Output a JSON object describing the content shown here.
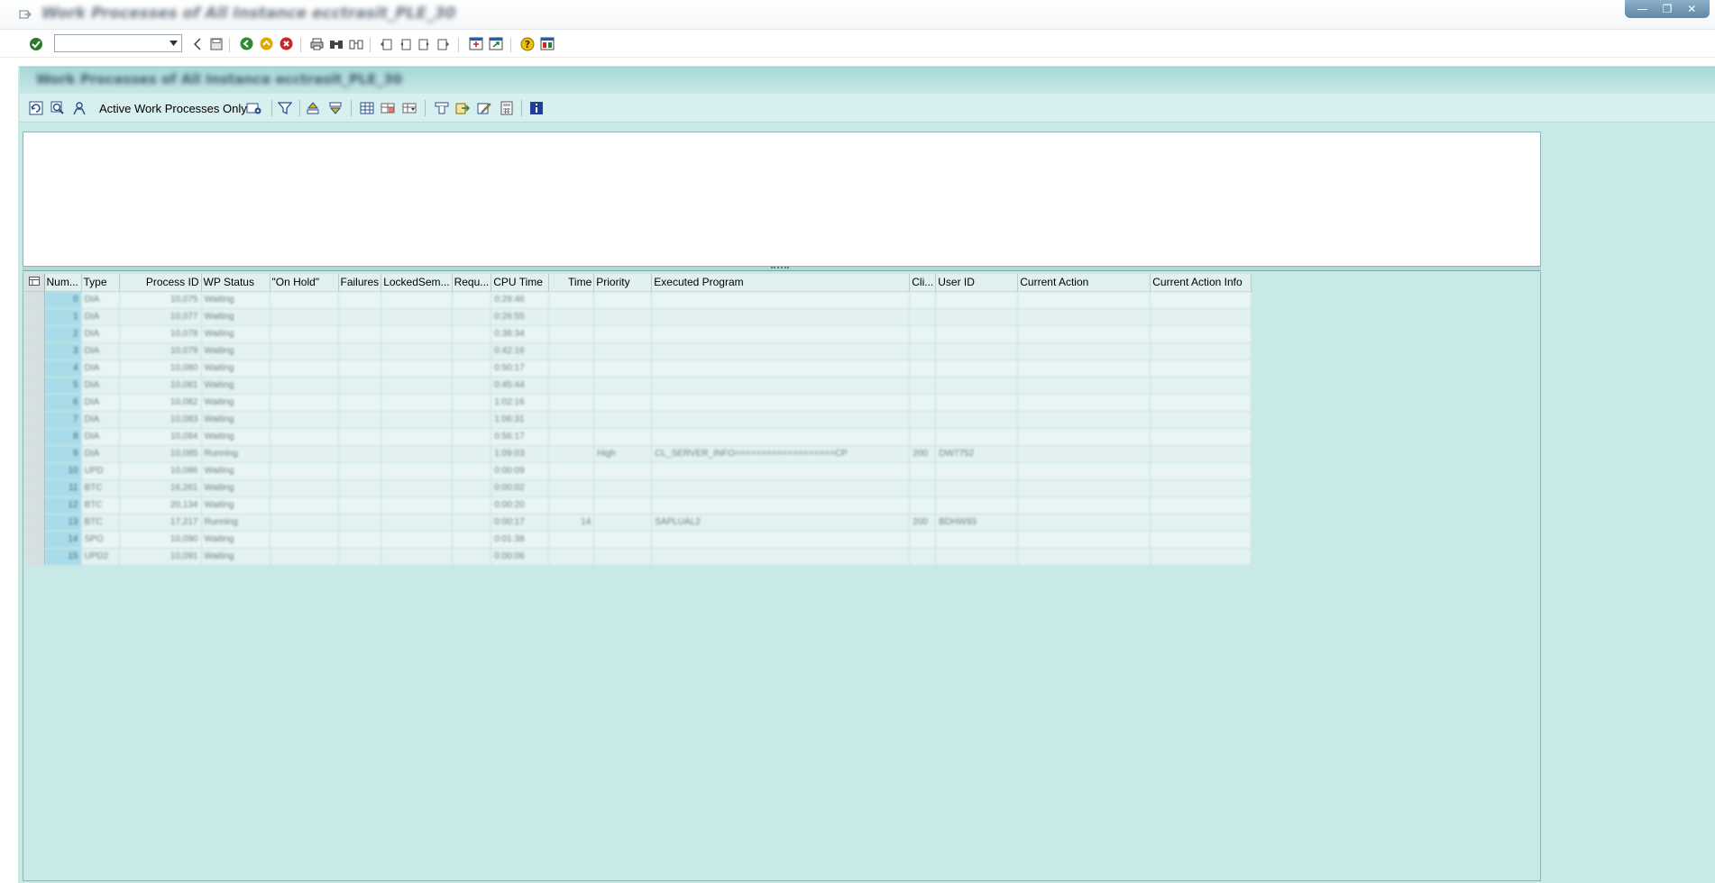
{
  "window": {
    "title": "Work Processes of All Instance ecctrasit_PLE_30",
    "controls": [
      "—",
      "❐",
      "✕"
    ]
  },
  "system_toolbar": {
    "command_field": {
      "value": "",
      "placeholder": ""
    },
    "icons": [
      "enter-icon",
      "back-icon",
      "save-icon",
      "back-green-icon",
      "exit-icon",
      "cancel-icon",
      "print-icon",
      "find-icon",
      "find-next-icon",
      "first-page-icon",
      "previous-page-icon",
      "next-page-icon",
      "last-page-icon",
      "create-session-icon",
      "shortcut-icon",
      "help-icon",
      "customize-layout-icon"
    ]
  },
  "app": {
    "title": "Work Processes of All Instance ecctrasit_PLE_30",
    "toolbar": {
      "active_only_label": "Active Work Processes Only"
    }
  },
  "grid": {
    "columns": [
      "Num...",
      "Type",
      "Process ID",
      "WP Status",
      "\"On Hold\"",
      "Failures",
      "LockedSem...",
      "Requ...",
      "CPU Time",
      "Time",
      "Priority",
      "Executed Program",
      "Cli...",
      "User ID",
      "Current Action",
      "Current Action Info"
    ],
    "rows": [
      [
        "0",
        "DIA",
        "10,075",
        "Waiting",
        "",
        "",
        "",
        "",
        "0:29:46",
        "",
        "",
        "",
        "",
        "",
        "",
        ""
      ],
      [
        "1",
        "DIA",
        "10,077",
        "Waiting",
        "",
        "",
        "",
        "",
        "0:26:55",
        "",
        "",
        "",
        "",
        "",
        "",
        ""
      ],
      [
        "2",
        "DIA",
        "10,078",
        "Waiting",
        "",
        "",
        "",
        "",
        "0:38:34",
        "",
        "",
        "",
        "",
        "",
        "",
        ""
      ],
      [
        "3",
        "DIA",
        "10,079",
        "Waiting",
        "",
        "",
        "",
        "",
        "0:42:16",
        "",
        "",
        "",
        "",
        "",
        "",
        ""
      ],
      [
        "4",
        "DIA",
        "10,080",
        "Waiting",
        "",
        "",
        "",
        "",
        "0:50:17",
        "",
        "",
        "",
        "",
        "",
        "",
        ""
      ],
      [
        "5",
        "DIA",
        "10,081",
        "Waiting",
        "",
        "",
        "",
        "",
        "0:45:44",
        "",
        "",
        "",
        "",
        "",
        "",
        ""
      ],
      [
        "6",
        "DIA",
        "10,082",
        "Waiting",
        "",
        "",
        "",
        "",
        "1:02:16",
        "",
        "",
        "",
        "",
        "",
        "",
        ""
      ],
      [
        "7",
        "DIA",
        "10,083",
        "Waiting",
        "",
        "",
        "",
        "",
        "1:06:31",
        "",
        "",
        "",
        "",
        "",
        "",
        ""
      ],
      [
        "8",
        "DIA",
        "10,084",
        "Waiting",
        "",
        "",
        "",
        "",
        "0:56:17",
        "",
        "",
        "",
        "",
        "",
        "",
        ""
      ],
      [
        "9",
        "DIA",
        "10,085",
        "Running",
        "",
        "",
        "",
        "",
        "1:09:03",
        "",
        "High",
        "CL_SERVER_INFO===================CP",
        "200",
        "DW7752",
        "",
        ""
      ],
      [
        "10",
        "UPD",
        "10,086",
        "Waiting",
        "",
        "",
        "",
        "",
        "0:00:09",
        "",
        "",
        "",
        "",
        "",
        "",
        ""
      ],
      [
        "11",
        "BTC",
        "16,261",
        "Waiting",
        "",
        "",
        "",
        "",
        "0:00:02",
        "",
        "",
        "",
        "",
        "",
        "",
        ""
      ],
      [
        "12",
        "BTC",
        "20,134",
        "Waiting",
        "",
        "",
        "",
        "",
        "0:00:20",
        "",
        "",
        "",
        "",
        "",
        "",
        ""
      ],
      [
        "13",
        "BTC",
        "17,217",
        "Running",
        "",
        "",
        "",
        "",
        "0:00:17",
        "14",
        "",
        "SAPLUAL2",
        "200",
        "BDHW93",
        "",
        ""
      ],
      [
        "14",
        "SPO",
        "10,090",
        "Waiting",
        "",
        "",
        "",
        "",
        "0:01:38",
        "",
        "",
        "",
        "",
        "",
        "",
        ""
      ],
      [
        "15",
        "UPD2",
        "10,091",
        "Waiting",
        "",
        "",
        "",
        "",
        "0:00:06",
        "",
        "",
        "",
        "",
        "",
        "",
        ""
      ]
    ]
  },
  "colors": {
    "frame_background": "#c9e9e7",
    "header_bar": "#a8d9d9",
    "row_number_cell": "#a9dce8"
  }
}
